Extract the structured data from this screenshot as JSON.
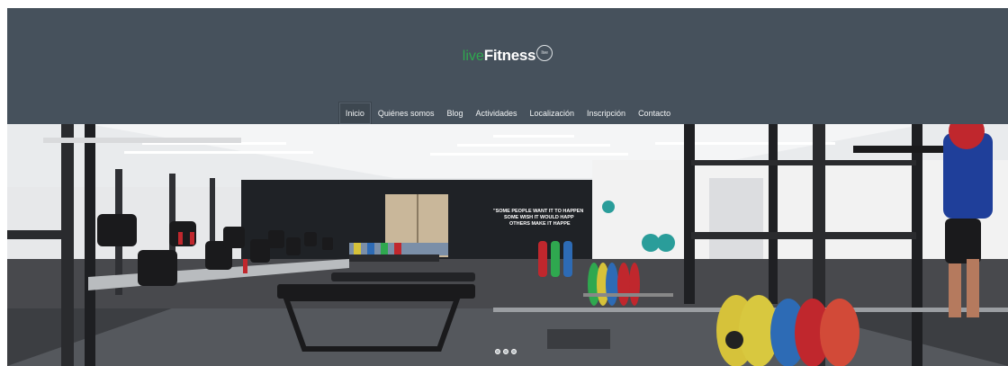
{
  "logo": {
    "prefix": "live",
    "name": "Fitness",
    "badge": "live"
  },
  "nav": [
    {
      "label": "Inicio",
      "active": true
    },
    {
      "label": "Quiénes somos"
    },
    {
      "label": "Blog"
    },
    {
      "label": "Actividades"
    },
    {
      "label": "Localización"
    },
    {
      "label": "Inscripción"
    },
    {
      "label": "Contacto"
    }
  ],
  "hero": {
    "quote_line1": "\"SOME PEOPLE WANT IT TO HAPPEN",
    "quote_line2": "SOME WISH IT WOULD HAPP",
    "quote_line3": "OTHERS MAKE IT HAPPE"
  },
  "slider": {
    "dots": 3
  },
  "colors": {
    "header": "#46515c",
    "accent": "#2fa84f"
  }
}
